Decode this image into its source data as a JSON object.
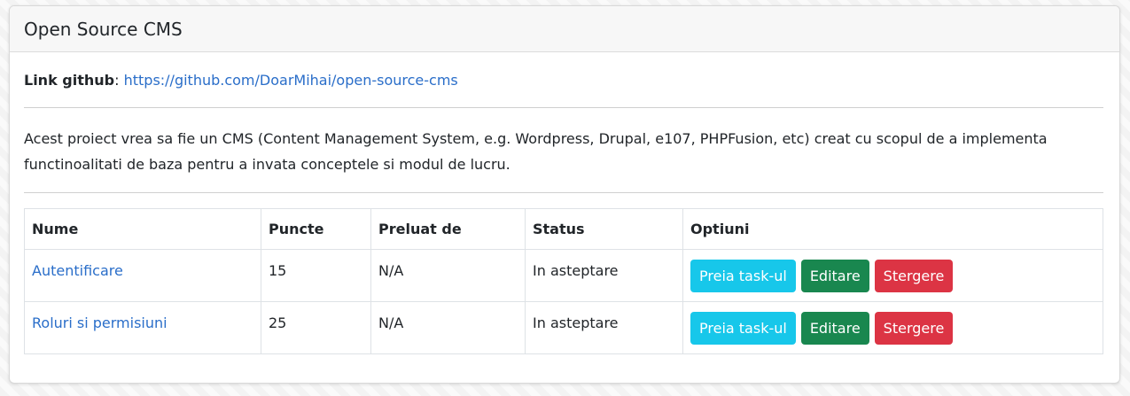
{
  "header": {
    "title": "Open Source CMS"
  },
  "github": {
    "label": "Link github",
    "separator": ":",
    "url_text": "https://github.com/DoarMihai/open-source-cms"
  },
  "description": "Acest proiect vrea sa fie un CMS (Content Management System, e.g. Wordpress, Drupal, e107, PHPFusion, etc) creat cu scopul de a implementa functinoalitati de baza pentru a invata conceptele si modul de lucru.",
  "table": {
    "headers": [
      "Nume",
      "Puncte",
      "Preluat de",
      "Status",
      "Optiuni"
    ],
    "rows": [
      {
        "name": "Autentificare",
        "points": "15",
        "taken_by": "N/A",
        "status": "In asteptare"
      },
      {
        "name": "Roluri si permisiuni",
        "points": "25",
        "taken_by": "N/A",
        "status": "In asteptare"
      }
    ],
    "buttons": {
      "take": "Preia task-ul",
      "edit": "Editare",
      "delete": "Stergere"
    }
  },
  "colors": {
    "link": "#2a6ec9",
    "info": "#17c7ea",
    "success": "#19874f",
    "danger": "#dc3444"
  }
}
